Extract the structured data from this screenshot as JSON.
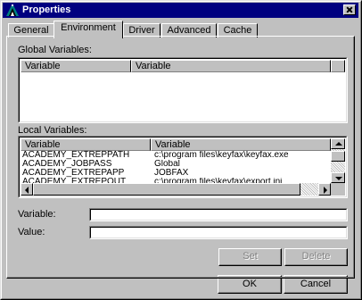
{
  "window": {
    "title": "Properties"
  },
  "tabs": [
    "General",
    "Environment",
    "Driver",
    "Advanced",
    "Cache"
  ],
  "active_tab": "Environment",
  "global_variables": {
    "label": "Global Variables:",
    "columns": [
      "Variable",
      "Variable"
    ],
    "rows": []
  },
  "local_variables": {
    "label": "Local Variables:",
    "columns": [
      "Variable",
      "Variable"
    ],
    "rows": [
      [
        "ACADEMY_EXTREPPATH",
        "c:\\program files\\keyfax\\keyfax.exe"
      ],
      [
        "ACADEMY_JOBPASS",
        "Global"
      ],
      [
        "ACADEMY_EXTREPAPP",
        "JOBFAX"
      ],
      [
        "ACADEMY_EXTREPOUT",
        "c:\\program files\\keyfax\\export.ini"
      ]
    ]
  },
  "fields": {
    "variable_label": "Variable:",
    "variable_value": "",
    "value_label": "Value:",
    "value_value": ""
  },
  "buttons": {
    "set": "Set",
    "delete": "Delete",
    "ok": "OK",
    "cancel": "Cancel"
  },
  "icons": {
    "app": "app-icon",
    "close": "close-icon"
  },
  "colors": {
    "titlebar": "#000080",
    "face": "#c0c0c0"
  }
}
